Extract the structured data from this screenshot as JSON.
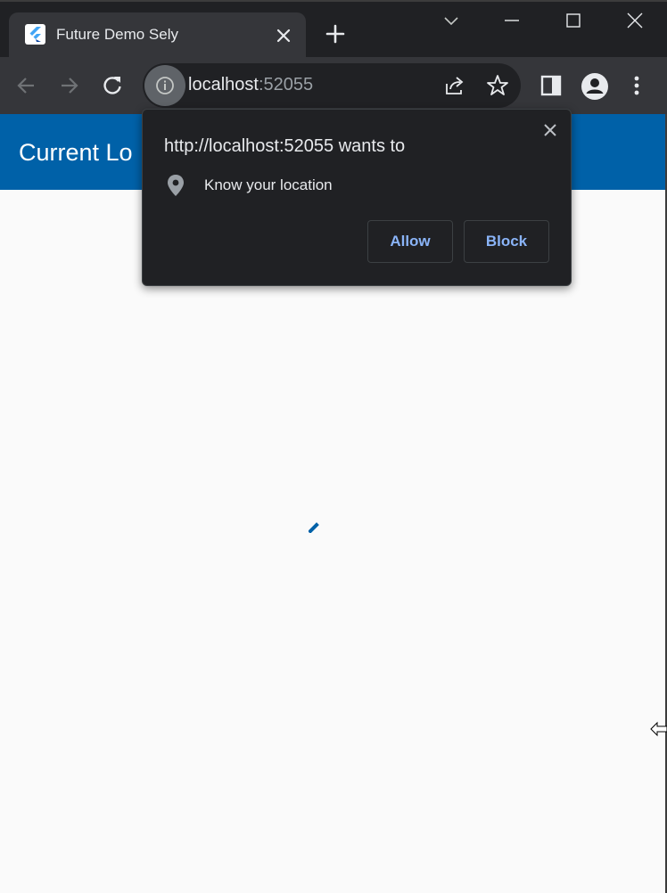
{
  "browser": {
    "tab": {
      "title": "Future Demo Sely",
      "favicon": "flutter-logo-icon"
    },
    "address_bar": {
      "host": "localhost",
      "port": ":52055"
    }
  },
  "app": {
    "title": "Current Lo"
  },
  "permission_prompt": {
    "title": "http://localhost:52055 wants to",
    "permission": "Know your location",
    "allow_label": "Allow",
    "block_label": "Block"
  },
  "colors": {
    "appbar": "#0061a8",
    "prompt_button_text": "#8ab4f8",
    "chrome_dark": "#202124"
  }
}
